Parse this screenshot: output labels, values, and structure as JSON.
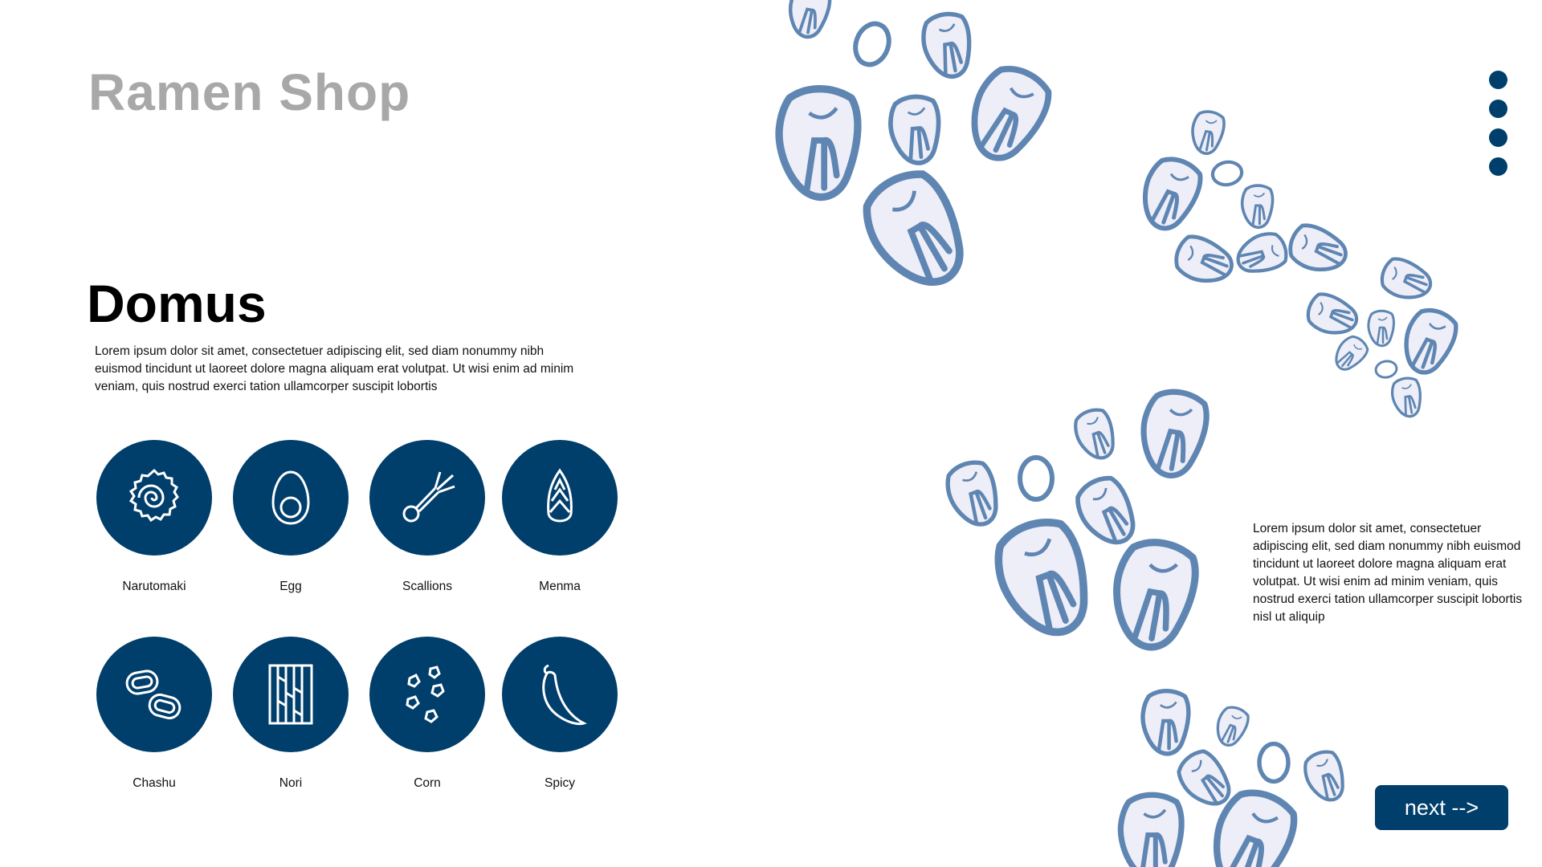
{
  "header": {
    "title": "Ramen Shop"
  },
  "main": {
    "heading": "Domus",
    "intro": "Lorem ipsum dolor sit amet, consectetuer adipiscing elit, sed diam nonummy nibh euismod tincidunt ut laoreet dolore magna aliquam erat volutpat. Ut wisi enim ad minim veniam, quis nostrud exerci tation ullamcorper suscipit lobortis",
    "side_text": "Lorem ipsum dolor sit amet, consectetuer adipiscing elit, sed diam nonummy nibh euismod tincidunt ut laoreet dolore magna aliquam erat volutpat. Ut wisi enim ad minim veniam, quis nostrud exerci tation ullamcorper suscipit lobortis nisl ut aliquip"
  },
  "toppings": [
    {
      "label": "Narutomaki",
      "icon": "narutomaki-icon"
    },
    {
      "label": "Egg",
      "icon": "egg-icon"
    },
    {
      "label": "Scallions",
      "icon": "scallion-icon"
    },
    {
      "label": "Menma",
      "icon": "menma-icon"
    },
    {
      "label": "Chashu",
      "icon": "chashu-icon"
    },
    {
      "label": "Nori",
      "icon": "nori-icon"
    },
    {
      "label": "Corn",
      "icon": "corn-icon"
    },
    {
      "label": "Spicy",
      "icon": "chili-pepper-icon"
    }
  ],
  "navigation": {
    "next_label": "next -->",
    "page_dots": 4
  },
  "colors": {
    "primary": "#003e6b",
    "title_gray": "#a8a8a8",
    "kernel_outline": "#5f86b2",
    "kernel_fill": "#eeeef8"
  }
}
